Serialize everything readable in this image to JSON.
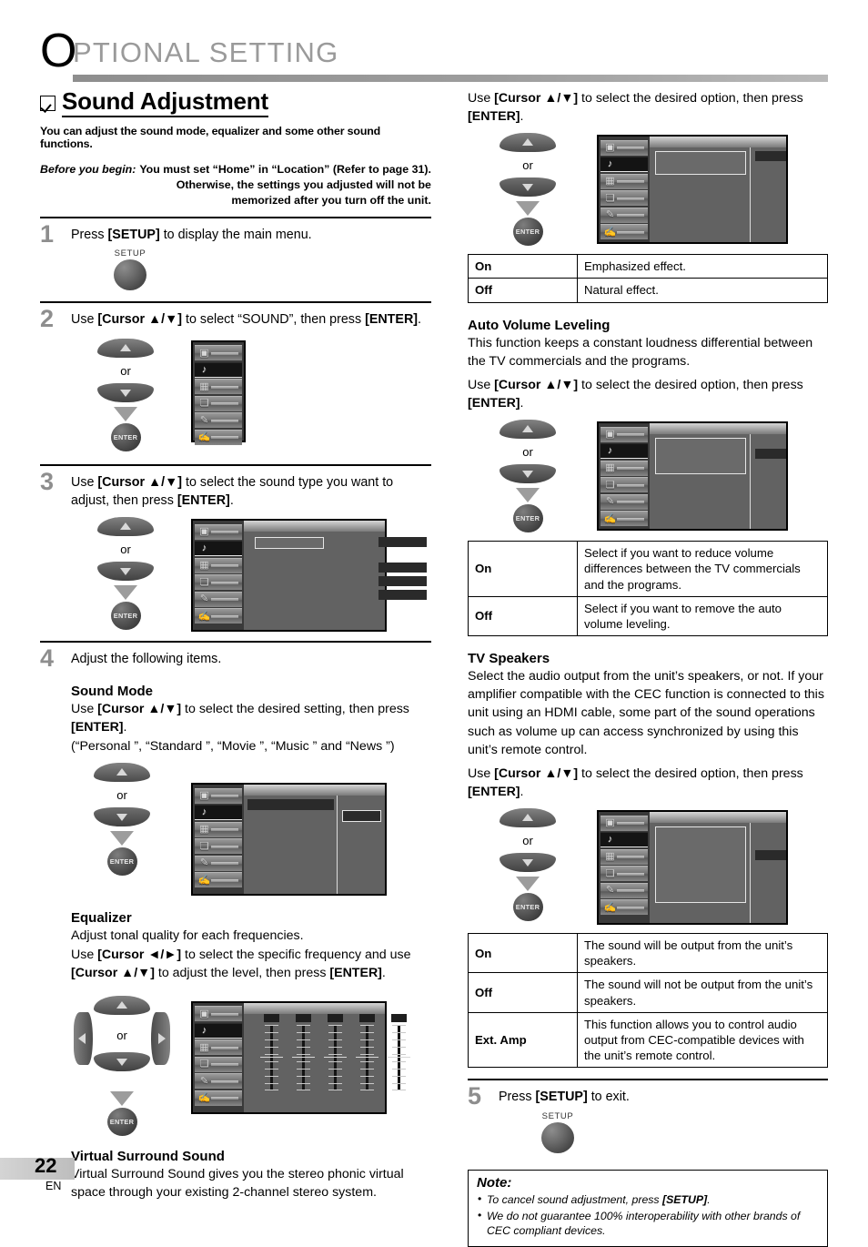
{
  "header": {
    "initial": "O",
    "title": "PTIONAL  SETTING"
  },
  "section": {
    "title": "Sound Adjustment",
    "subtitle": "You can adjust the sound mode, equalizer and some other sound functions.",
    "before_label": "Before you begin:",
    "before_line1": "You must set “Home” in “Location” (Refer to page 31).",
    "before_line2": "Otherwise, the settings you adjusted will not be",
    "before_line3": "memorized after you turn off the unit."
  },
  "steps": {
    "s1": {
      "num": "1",
      "text_a": "Press ",
      "text_b": "[SETUP]",
      "text_c": " to display the main menu."
    },
    "s2": {
      "num": "2",
      "a": "Use ",
      "b": "[Cursor ▲/▼]",
      "c": " to select “SOUND”, then press ",
      "d": "[ENTER]",
      "e": "."
    },
    "s3": {
      "num": "3",
      "a": "Use ",
      "b": "[Cursor ▲/▼]",
      "c": " to select the sound type you want to adjust, then press ",
      "d": "[ENTER]",
      "e": "."
    },
    "s4": {
      "num": "4",
      "text": "Adjust the following items."
    },
    "s5": {
      "num": "5",
      "a": "Press ",
      "b": "[SETUP]",
      "c": " to exit."
    }
  },
  "remote": {
    "setup_label": "SETUP",
    "enter_label": "ENTER",
    "or_label": "or"
  },
  "sound_mode": {
    "heading": "Sound Mode",
    "a": "Use ",
    "b": "[Cursor ▲/▼]",
    "c": " to select the desired setting, then press ",
    "d": "[ENTER]",
    "e": ".",
    "options_line": "(“Personal ”, “Standard ”, “Movie ”, “Music ” and “News ”)"
  },
  "equalizer": {
    "heading": "Equalizer",
    "line1": "Adjust tonal quality for each frequencies.",
    "a": "Use ",
    "b": "[Cursor ◄/►]",
    "c": " to select the specific frequency and use ",
    "d": "[Cursor ▲/▼]",
    "e": " to adjust the level, then press ",
    "f": "[ENTER]",
    "g": "."
  },
  "virtual_surround": {
    "heading": "Virtual Surround Sound",
    "body": "Virtual Surround Sound gives you the stereo phonic virtual space through your existing 2-channel stereo system.",
    "use_a": "Use ",
    "use_b": "[Cursor ▲/▼]",
    "use_c": " to select the desired option, then press ",
    "use_d": "[ENTER]",
    "use_e": ".",
    "table": [
      {
        "key": "On",
        "desc": "Emphasized effect."
      },
      {
        "key": "Off",
        "desc": "Natural effect."
      }
    ]
  },
  "auto_volume": {
    "heading": "Auto Volume Leveling",
    "body": "This function keeps a constant loudness differential between the TV commercials and the programs.",
    "use_a": "Use ",
    "use_b": "[Cursor ▲/▼]",
    "use_c": " to select the desired option, then press ",
    "use_d": "[ENTER]",
    "use_e": ".",
    "table": [
      {
        "key": "On",
        "desc": "Select if you want to reduce volume differences between the TV commercials and the programs."
      },
      {
        "key": "Off",
        "desc": "Select if you want to remove the auto volume leveling."
      }
    ]
  },
  "tv_speakers": {
    "heading": "TV Speakers",
    "body": "Select the audio output from the unit’s speakers, or not. If your amplifier compatible with the CEC function is connected to this unit using an HDMI cable, some part of the sound operations such as volume up can access synchronized by using this unit’s remote control.",
    "use_a": "Use ",
    "use_b": "[Cursor ▲/▼]",
    "use_c": " to select the desired option, then press ",
    "use_d": "[ENTER]",
    "use_e": ".",
    "table": [
      {
        "key": "On",
        "desc": "The sound will be output from the unit’s speakers."
      },
      {
        "key": "Off",
        "desc": "The sound will not be output from the unit’s speakers."
      },
      {
        "key": "Ext. Amp",
        "desc": "This function allows you to control audio output from CEC-compatible devices with the unit’s remote control."
      }
    ]
  },
  "note": {
    "title": "Note:",
    "item1_a": "To cancel sound adjustment, press ",
    "item1_b": "[SETUP]",
    "item1_c": ".",
    "item2": "We do not guarantee 100% interoperability with other brands of CEC compliant devices."
  },
  "tv_menu": {
    "icons": [
      "picture-icon",
      "sound-icon",
      "channel-icon",
      "parental-icon",
      "setup-icon",
      "edit-icon"
    ],
    "selected_index": 1
  },
  "footer": {
    "page_number": "22",
    "language": "EN"
  },
  "colors": {
    "header_gray": "#9a9a9a",
    "step_number_gray": "#8e8e8e",
    "menu_bg": "#626262",
    "menu_side": "#3a3a3a",
    "highlight": "#2a2a2a"
  }
}
